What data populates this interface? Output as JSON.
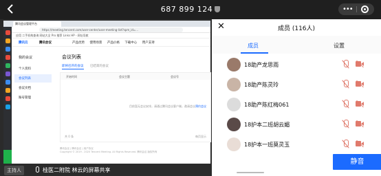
{
  "call": {
    "meeting_id": "687 899 124",
    "shield_icon": "shield-icon",
    "more_icon": "more-dots-icon",
    "exit_icon": "ring-target-icon"
  },
  "share": {
    "browser_tab": "腾讯会议管理平台",
    "url": "https://meeting.tencent.com/user-center/user-meeting-list?spm_id=...",
    "bookmarks": "应用  二手机构查询  网站大全  Pro 推荐  Links  HP - 网址导航",
    "site": {
      "logo1": "腾讯云",
      "logo2": "腾讯会议",
      "nav": [
        "产品优势",
        "使用场景",
        "产品价格",
        "下载中心",
        "用户支持"
      ]
    },
    "sidebar": {
      "title": "我的会议",
      "items": [
        "个人资料",
        "会议列表",
        "会议文档",
        "账号管理"
      ]
    },
    "main": {
      "title": "会议列表",
      "tab_active": "即将召开的会议",
      "tab_other": "已结束的会议",
      "columns": [
        "开始时间",
        "会议主题",
        "会议号"
      ],
      "empty_text": "目前暂无会议安排，请通过腾讯会议客户端，邀请会议",
      "empty_link": "预约会议",
      "pager_left": "共 0 条",
      "pager_right": "每页显示"
    },
    "footer_lines": [
      "腾讯会议 | 腾讯会议 | 用户协议",
      "Copyright © 2019 - 2020 Tencent Meeting. All Rights Reserved. 腾讯会议 版权所有"
    ]
  },
  "speaker": {
    "host_label": "主持人",
    "text": "桂医二附院 林云的屏幕共享"
  },
  "panel": {
    "title": "成员 (116人)",
    "tab_members": "成员",
    "tab_settings": "设置",
    "members": [
      {
        "name": "18助产龙思雨",
        "avatar_color": "#9a7a6a"
      },
      {
        "name": "18助产陈灵玲",
        "avatar_color": "#c9b4a6"
      },
      {
        "name": "18助产陈红梅061",
        "avatar_color": "#dcdcdc"
      },
      {
        "name": "18护本二班胡云媚",
        "avatar_color": "#5a4a48"
      },
      {
        "name": "18护本一班莫灵玉",
        "avatar_color": "#e9ddd6"
      }
    ],
    "mute_all": "静音"
  }
}
